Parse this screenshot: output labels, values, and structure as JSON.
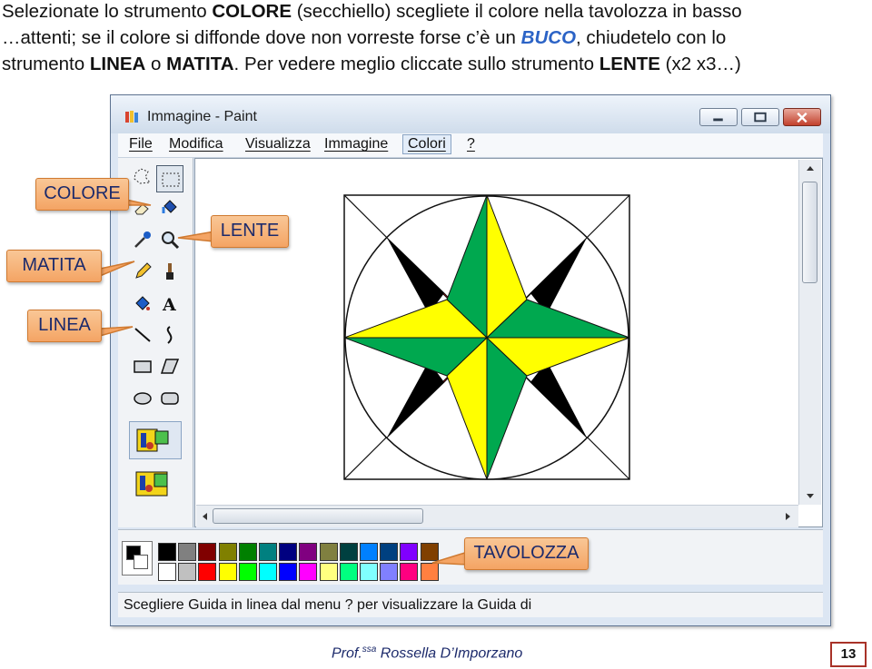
{
  "instructions": {
    "l1_a": "Selezionate lo strumento ",
    "l1_b": "COLORE",
    "l1_c": " (secchiello) scegliete il colore nella tavolozza in basso",
    "l2_a": "…attenti; se il colore si diffonde dove non vorreste forse c’è un ",
    "l2_b": "BUCO",
    "l2_c": ", chiudetelo  con lo",
    "l3_a": "strumento ",
    "l3_b": "LINEA",
    "l3_c": " o ",
    "l3_d": "MATITA",
    "l3_e": ". Per vedere meglio cliccate sullo strumento ",
    "l3_f": "LENTE",
    "l3_g": " (x2 x3…)"
  },
  "window": {
    "title": "Immagine - Paint",
    "menu": [
      "File",
      "Modifica",
      "Visualizza",
      "Immagine",
      "Colori",
      "?"
    ],
    "active_menu": "Colori",
    "status": "Scegliere Guida in linea dal menu ? per visualizzare la Guida di"
  },
  "tools": [
    "free-select",
    "rect-select",
    "eraser",
    "fill",
    "color-picker",
    "magnifier",
    "pencil",
    "brush",
    "airbrush",
    "text",
    "line",
    "curve",
    "rectangle",
    "polygon",
    "ellipse",
    "rounded-rectangle"
  ],
  "palette": {
    "row1": [
      "#000000",
      "#808080",
      "#800000",
      "#808000",
      "#008000",
      "#008080",
      "#000080",
      "#800080",
      "#808040",
      "#004040",
      "#0080ff",
      "#004080",
      "#8000ff",
      "#804000"
    ],
    "row2": [
      "#ffffff",
      "#c0c0c0",
      "#ff0000",
      "#ffff00",
      "#00ff00",
      "#00ffff",
      "#0000ff",
      "#ff00ff",
      "#ffff80",
      "#00ff80",
      "#80ffff",
      "#8080ff",
      "#ff0080",
      "#ff8040"
    ],
    "primary": "#000000",
    "secondary": "#ffffff"
  },
  "callouts": {
    "colore": "COLORE",
    "matita": "MATITA",
    "linea": "LINEA",
    "lente": "LENTE",
    "tavolozza": "TAVOLOZZA"
  },
  "drawing_colors": {
    "red": "#ff0000",
    "green": "#00a84f",
    "yellow": "#ffff00",
    "black": "#000000"
  },
  "footer": {
    "author_a": "Prof.",
    "author_sup": "ssa",
    "author_b": " Rossella D’Imporzano",
    "page": "13"
  }
}
